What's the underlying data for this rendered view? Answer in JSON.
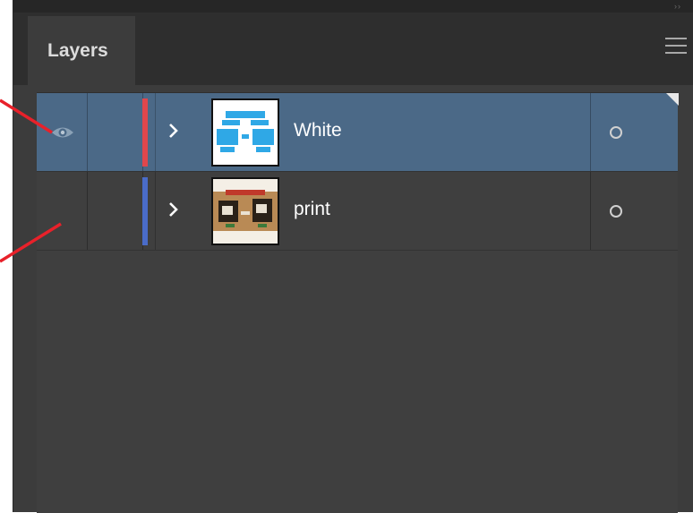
{
  "panel": {
    "tab_label": "Layers",
    "menu_icon": "hamburger-menu-icon"
  },
  "layers": [
    {
      "name": "White",
      "selected": true,
      "visible": true,
      "expand_icon": "chevron-right-icon",
      "color": "#e0474c",
      "target_icon": "target-circle-icon"
    },
    {
      "name": "print",
      "selected": false,
      "visible": false,
      "expand_icon": "chevron-right-icon",
      "color": "#4a6cc9",
      "target_icon": "target-circle-icon"
    }
  ],
  "colors": {
    "panel_bg": "#3c3c3c",
    "selection": "#4b6987",
    "annotation": "#e8212a"
  }
}
